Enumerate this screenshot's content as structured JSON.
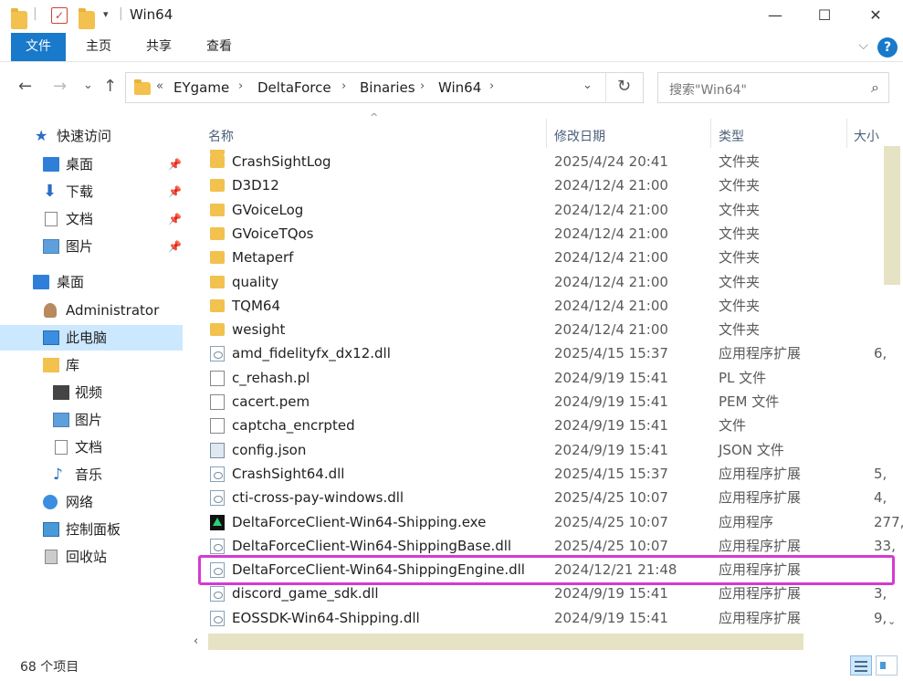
{
  "window": {
    "title": "Win64",
    "minimize": "—",
    "maximize": "☐",
    "close": "✕"
  },
  "ribbon": {
    "tabs": [
      "文件",
      "主页",
      "共享",
      "查看"
    ],
    "expand": "⌵",
    "help": "?"
  },
  "address": {
    "back": "←",
    "forward": "→",
    "recent": "⌄",
    "up": "↑",
    "overflow": "«",
    "crumbs": [
      "EYgame",
      "DeltaForce",
      "Binaries",
      "Win64"
    ],
    "sep": "›",
    "dropdown": "⌄",
    "refresh": "↻"
  },
  "search": {
    "placeholder": "搜索\"Win64\"",
    "icon": "⌕"
  },
  "nav": {
    "pin": "📌",
    "items": [
      {
        "label": "快速访问",
        "icon": "star-icon"
      },
      {
        "label": "桌面",
        "icon": "desktop-icon",
        "pinned": true
      },
      {
        "label": "下载",
        "icon": "download-icon",
        "pinned": true
      },
      {
        "label": "文档",
        "icon": "document-icon",
        "pinned": true
      },
      {
        "label": "图片",
        "icon": "pictures-icon",
        "pinned": true
      },
      {
        "label": "桌面",
        "icon": "desktop-icon"
      },
      {
        "label": "Administrator",
        "icon": "user-icon"
      },
      {
        "label": "此电脑",
        "icon": "computer-icon",
        "selected": true
      },
      {
        "label": "库",
        "icon": "library-icon"
      },
      {
        "label": "视频",
        "icon": "video-icon"
      },
      {
        "label": "图片",
        "icon": "pictures-icon"
      },
      {
        "label": "文档",
        "icon": "document-icon"
      },
      {
        "label": "音乐",
        "icon": "music-icon"
      },
      {
        "label": "网络",
        "icon": "network-icon"
      },
      {
        "label": "控制面板",
        "icon": "control-panel-icon"
      },
      {
        "label": "回收站",
        "icon": "recycle-bin-icon"
      }
    ]
  },
  "columns": {
    "sort_arrow": "^",
    "name": "名称",
    "date": "修改日期",
    "type": "类型",
    "size": "大小"
  },
  "files": [
    {
      "name": "CrashSightLog",
      "date": "2025/4/24 20:41",
      "type": "文件夹",
      "size": "",
      "kind": "folder"
    },
    {
      "name": "D3D12",
      "date": "2024/12/4 21:00",
      "type": "文件夹",
      "size": "",
      "kind": "folder"
    },
    {
      "name": "GVoiceLog",
      "date": "2024/12/4 21:00",
      "type": "文件夹",
      "size": "",
      "kind": "folder"
    },
    {
      "name": "GVoiceTQos",
      "date": "2024/12/4 21:00",
      "type": "文件夹",
      "size": "",
      "kind": "folder"
    },
    {
      "name": "Metaperf",
      "date": "2024/12/4 21:00",
      "type": "文件夹",
      "size": "",
      "kind": "folder"
    },
    {
      "name": "quality",
      "date": "2024/12/4 21:00",
      "type": "文件夹",
      "size": "",
      "kind": "folder"
    },
    {
      "name": "TQM64",
      "date": "2024/12/4 21:00",
      "type": "文件夹",
      "size": "",
      "kind": "folder"
    },
    {
      "name": "wesight",
      "date": "2024/12/4 21:00",
      "type": "文件夹",
      "size": "",
      "kind": "folder"
    },
    {
      "name": "amd_fidelityfx_dx12.dll",
      "date": "2025/4/15 15:37",
      "type": "应用程序扩展",
      "size": "6,",
      "kind": "dll"
    },
    {
      "name": "c_rehash.pl",
      "date": "2024/9/19 15:41",
      "type": "PL 文件",
      "size": "",
      "kind": "file"
    },
    {
      "name": "cacert.pem",
      "date": "2024/9/19 15:41",
      "type": "PEM 文件",
      "size": "",
      "kind": "file"
    },
    {
      "name": "captcha_encrpted",
      "date": "2024/9/19 15:41",
      "type": "文件",
      "size": "",
      "kind": "file"
    },
    {
      "name": "config.json",
      "date": "2024/9/19 15:41",
      "type": "JSON 文件",
      "size": "",
      "kind": "json"
    },
    {
      "name": "CrashSight64.dll",
      "date": "2025/4/15 15:37",
      "type": "应用程序扩展",
      "size": "5,",
      "kind": "dll"
    },
    {
      "name": "cti-cross-pay-windows.dll",
      "date": "2025/4/25 10:07",
      "type": "应用程序扩展",
      "size": "4,",
      "kind": "dll"
    },
    {
      "name": "DeltaForceClient-Win64-Shipping.exe",
      "date": "2025/4/25 10:07",
      "type": "应用程序",
      "size": "277,",
      "kind": "exe"
    },
    {
      "name": "DeltaForceClient-Win64-ShippingBase.dll",
      "date": "2025/4/25 10:07",
      "type": "应用程序扩展",
      "size": "33,",
      "kind": "dll"
    },
    {
      "name": "DeltaForceClient-Win64-ShippingEngine.dll",
      "date": "2024/12/21 21:48",
      "type": "应用程序扩展",
      "size": "",
      "kind": "dll"
    },
    {
      "name": "discord_game_sdk.dll",
      "date": "2024/9/19 15:41",
      "type": "应用程序扩展",
      "size": "3,",
      "kind": "dll"
    },
    {
      "name": "EOSSDK-Win64-Shipping.dll",
      "date": "2024/9/19 15:41",
      "type": "应用程序扩展",
      "size": "9,",
      "kind": "dll"
    }
  ],
  "highlighted_file": "DeltaForceClient-Win64-ShippingEngine.dll",
  "scroll": {
    "down": "⌄",
    "left": "‹"
  },
  "status": {
    "item_count": "68 个项目"
  },
  "colors": {
    "accent": "#1979ca",
    "selection": "#cce8ff",
    "highlight_border": "#d43ad4"
  }
}
